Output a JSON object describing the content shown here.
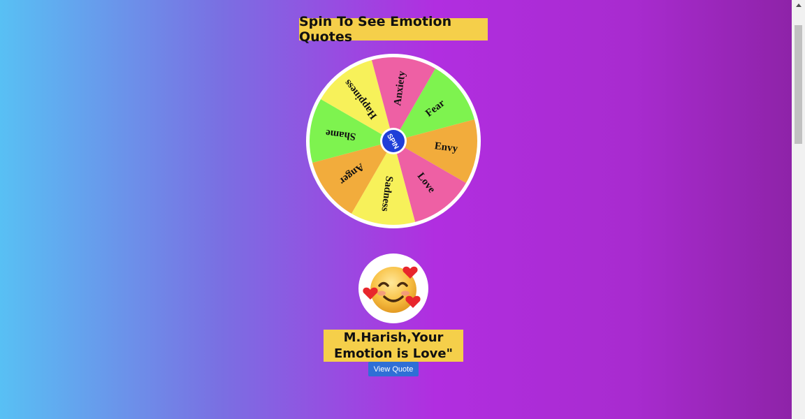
{
  "header": {
    "title": "Spin To See Emotion Quotes"
  },
  "wheel": {
    "spin_label": "SPIN",
    "segments": [
      {
        "label": "Fear",
        "color": "#7ef34f"
      },
      {
        "label": "Envy",
        "color": "#f2ac3c"
      },
      {
        "label": "Love",
        "color": "#ee60a4"
      },
      {
        "label": "Sadness",
        "color": "#f7f15a"
      },
      {
        "label": "Anger",
        "color": "#f2ac3c"
      },
      {
        "label": "Shame",
        "color": "#7ef34f"
      },
      {
        "label": "Happiness",
        "color": "#f7f15a"
      },
      {
        "label": "Anxiety",
        "color": "#ee60a4"
      }
    ],
    "spin_color": "#1f3fd8"
  },
  "result": {
    "line1": "M.Harish,Your",
    "line2": "Emotion is Love\"",
    "emoji_icon": "smiling-face-with-hearts-icon"
  },
  "actions": {
    "view_quote_label": "View Quote"
  }
}
